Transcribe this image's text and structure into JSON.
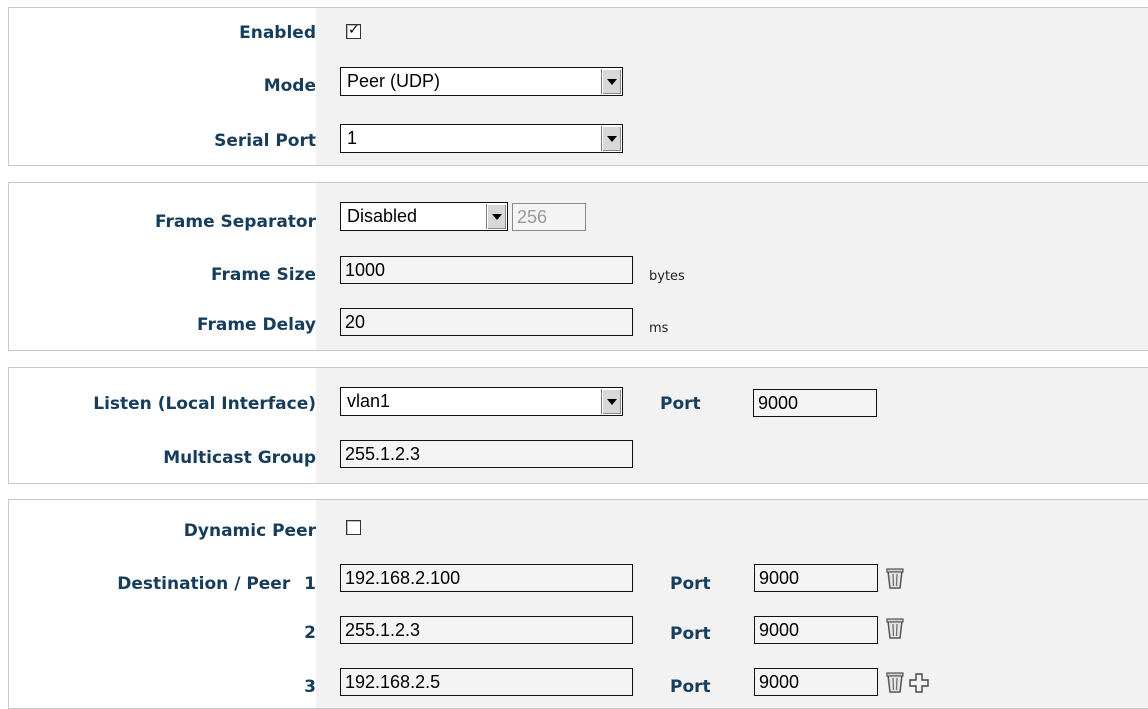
{
  "general": {
    "enabled_label": "Enabled",
    "enabled_checked": true,
    "mode_label": "Mode",
    "mode_value": "Peer (UDP)",
    "serial_port_label": "Serial Port",
    "serial_port_value": "1"
  },
  "framing": {
    "separator_label": "Frame Separator",
    "separator_value": "Disabled",
    "separator_char": "256",
    "size_label": "Frame Size",
    "size_value": "1000",
    "size_unit": "bytes",
    "delay_label": "Frame Delay",
    "delay_value": "20",
    "delay_unit": "ms"
  },
  "listen": {
    "interface_label": "Listen (Local Interface)",
    "interface_value": "vlan1",
    "port_label": "Port",
    "port_value": "9000",
    "multicast_label": "Multicast Group",
    "multicast_value": "255.1.2.3"
  },
  "peers": {
    "dynamic_label": "Dynamic Peer",
    "dynamic_checked": false,
    "destination_label": "Destination / Peer",
    "port_label": "Port",
    "rows": [
      {
        "index": "1",
        "address": "192.168.2.100",
        "port": "9000"
      },
      {
        "index": "2",
        "address": "255.1.2.3",
        "port": "9000"
      },
      {
        "index": "3",
        "address": "192.168.2.5",
        "port": "9000"
      }
    ],
    "icons": {
      "delete": "trash-icon",
      "add": "plus-icon"
    }
  }
}
